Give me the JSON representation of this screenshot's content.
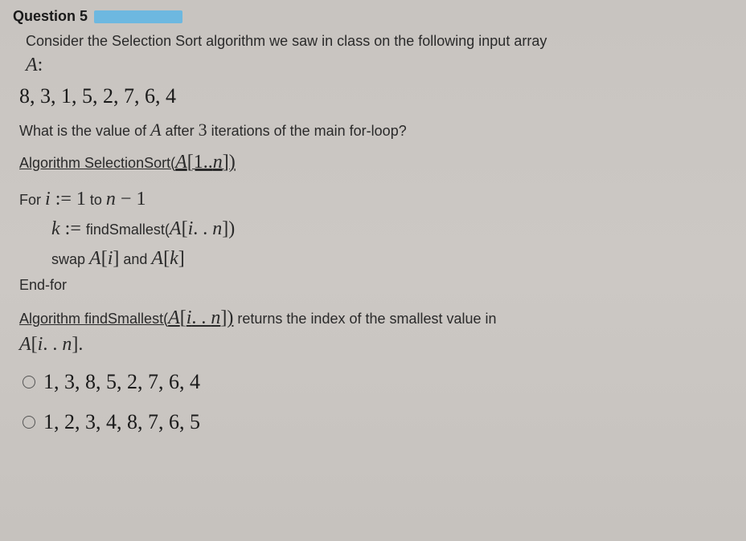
{
  "header": {
    "label": "Question 5"
  },
  "intro": {
    "text": "Consider the Selection Sort algorithm we saw in class on the following input array",
    "arrayName": "A",
    "colon": ":"
  },
  "inputArray": "8, 3, 1, 5, 2, 7, 6, 4",
  "question": {
    "pre": "What is the value of ",
    "var": "A",
    "mid": " after ",
    "num": "3",
    "post": " iterations of the main for-loop?"
  },
  "algo1": {
    "prefix": "Algorithm SelectionSort(",
    "arg": "A",
    "range": "[1..",
    "n": "n",
    "close": "])"
  },
  "loop": {
    "for": "For ",
    "i": "i",
    "assign": " := ",
    "one": "1",
    "to": " to ",
    "n": "n",
    "minus": " − ",
    "one2": "1",
    "kline_k": "k",
    "kline_assign": " := ",
    "kline_func": "findSmallest(",
    "kline_A": "A",
    "kline_open": "[",
    "kline_i": "i",
    "kline_dots": ". . ",
    "kline_n": "n",
    "kline_close": "])",
    "swap_pre": "swap ",
    "swap_Ai_A": "A",
    "swap_Ai_open": "[",
    "swap_Ai_i": "i",
    "swap_Ai_close": "]",
    "swap_and": " and ",
    "swap_Ak_A": "A",
    "swap_Ak_open": "[",
    "swap_Ak_k": "k",
    "swap_Ak_close": "]",
    "endfor": "End-for"
  },
  "algo2": {
    "prefix": "Algorithm findSmallest(",
    "A": "A",
    "open": "[",
    "i": "i",
    "dots": ". . ",
    "n": "n",
    "close": "])",
    "returns": " returns the index of the smallest value in"
  },
  "ain": {
    "A": "A",
    "open": "[",
    "i": "i",
    "dots": ". . ",
    "n": "n",
    "close": "]",
    "period": "."
  },
  "options": [
    {
      "text": "1, 3, 8, 5, 2, 7, 6, 4"
    },
    {
      "text": "1, 2, 3, 4, 8, 7, 6, 5"
    }
  ]
}
